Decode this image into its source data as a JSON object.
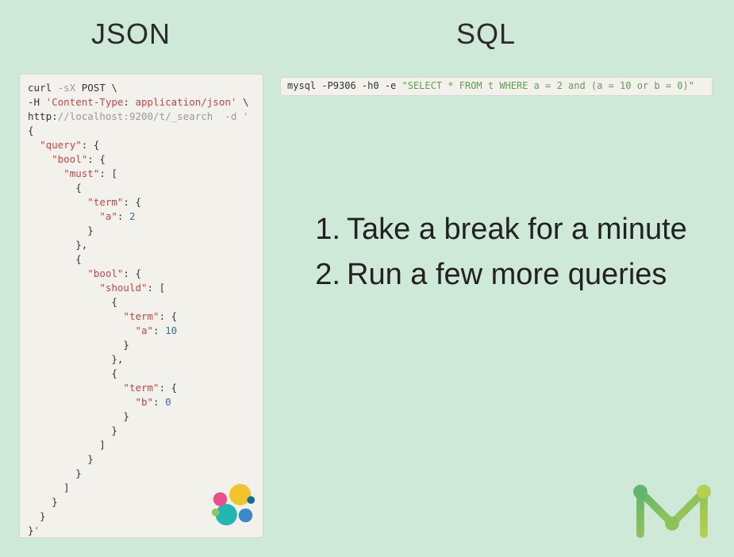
{
  "headings": {
    "json": "JSON",
    "sql": "SQL"
  },
  "json_code": {
    "l1a": "curl ",
    "l1b": "-sX",
    "l1c": " POST \\",
    "l2a": "-H ",
    "l2b": "'Content-Type",
    "l2c": ":",
    "l2d": " application/json'",
    "l2e": " \\",
    "l3a": "http:",
    "l3b": "//localhost:9200/t/_search  -d '",
    "l4": "{",
    "l5a": "  ",
    "l5b": "\"query\"",
    "l5c": ": {",
    "l6a": "    ",
    "l6b": "\"bool\"",
    "l6c": ": {",
    "l7a": "      ",
    "l7b": "\"must\"",
    "l7c": ": [",
    "l8": "        {",
    "l9a": "          ",
    "l9b": "\"term\"",
    "l9c": ": {",
    "l10a": "            ",
    "l10b": "\"a\"",
    "l10c": ": ",
    "l10d": "2",
    "l11": "          }",
    "l12": "        },",
    "l13": "        {",
    "l14a": "          ",
    "l14b": "\"bool\"",
    "l14c": ": {",
    "l15a": "            ",
    "l15b": "\"should\"",
    "l15c": ": [",
    "l16": "              {",
    "l17a": "                ",
    "l17b": "\"term\"",
    "l17c": ": {",
    "l18a": "                  ",
    "l18b": "\"a\"",
    "l18c": ": ",
    "l18d": "10",
    "l19": "                }",
    "l20": "              },",
    "l21": "              {",
    "l22a": "                ",
    "l22b": "\"term\"",
    "l22c": ": {",
    "l23a": "                  ",
    "l23b": "\"b\"",
    "l23c": ": ",
    "l23d": "0",
    "l24": "                }",
    "l25": "              }",
    "l26": "            ]",
    "l27": "          }",
    "l28": "        }",
    "l29": "      ]",
    "l30": "    }",
    "l31": "  }",
    "l32a": "}",
    "l32b": "'"
  },
  "sql_code": {
    "prefix": "mysql -P9306 -h0 -e ",
    "query": "\"SELECT * FROM t WHERE a = 2 and (a = 10 or b = 0)\""
  },
  "list": {
    "item1_num": "1.",
    "item1": "Take a break for a minute",
    "item2_num": "2.",
    "item2": "Run a few more queries"
  }
}
